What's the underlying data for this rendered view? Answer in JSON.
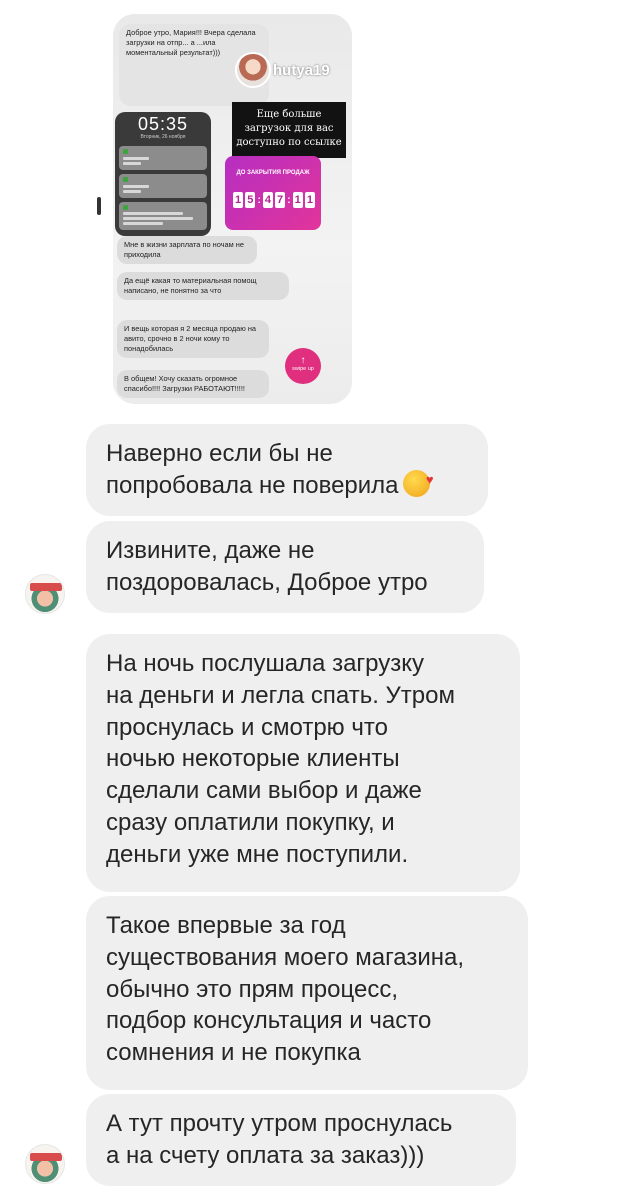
{
  "story": {
    "top_message": "Доброе утро, Мария!!! Вчера сделала загрузки на отпр... а ...ила моментальный результат)))",
    "username": "hutya19",
    "lock_time": "05:35",
    "lock_date": "Вторник, 26 ноября",
    "more_loads_label": "Еще больше загрузок для вас доступно по ссылке",
    "countdown_title": "ДО ЗАКРЫТИЯ ПРОДАЖ",
    "countdown_digits": [
      "1",
      "5",
      "4",
      "7",
      "1",
      "1"
    ],
    "messages": [
      "Мне в жизни зарплата по ночам не приходила",
      "Да ещё какая то материальная помощ написано, не понятно за что",
      "И вещь которая я 2 месяца продаю на авито, срочно в 2 ночи кому то понадобилась",
      "В общем! Хочу сказать огромное спасибо!!!! Загрузки РАБОТАЮТ!!!!!"
    ],
    "swipe_up": "swipe up"
  },
  "chat": {
    "messages": [
      {
        "lines": [
          "Наверно если бы не",
          "попробовала не поверила"
        ]
      },
      {
        "lines": [
          "Извините, даже не",
          "поздоровалась, Доброе утро"
        ]
      },
      {
        "lines": [
          "На ночь послушала загрузку",
          "на деньги и легла спать. Утром",
          "проснулась и смотрю что",
          "ночью некоторые клиенты",
          "сделали сами выбор и даже",
          "сразу оплатили покупку, и",
          "деньги уже мне поступили."
        ]
      },
      {
        "lines": [
          "Такое впервые за год",
          "существования моего магазина,",
          "обычно это прям процесс,",
          "подбор консультация и часто",
          "сомнения и не покупка"
        ]
      },
      {
        "lines": [
          "А тут прочту утром проснулась",
          "а на счету оплата за заказ)))"
        ]
      }
    ]
  },
  "colors": {
    "bubble_bg": "#efefef",
    "text": "#262626",
    "swipe": "#e02f7e"
  }
}
